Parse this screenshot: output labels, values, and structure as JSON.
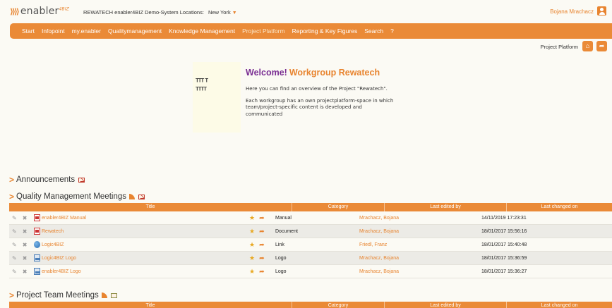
{
  "header": {
    "logo_text": "enabler",
    "logo_sup": "4BIZ",
    "org_label": "REWATECH enabler4BIZ Demo-System",
    "locations_label": "Locations:",
    "location": "New York",
    "user_name": "Bojana Mrachacz"
  },
  "nav": {
    "items": [
      "Start",
      "Infopoint",
      "my.enabler",
      "Qualitymanagement",
      "Knowledge Management",
      "Project Platform",
      "Reporting & Key Figures",
      "Search",
      "?"
    ]
  },
  "breadcrumb": "Project Platform",
  "welcome": {
    "title": "Welcome!",
    "group": "Workgroup Rewatech",
    "p1": "Here you can find an overview of the Project \"Rewatech\".",
    "p2": "Each workgroup has an own projectplatform-space in which team/project-specific content is developed and communicated"
  },
  "sections": {
    "announcements": "Announcements",
    "qm_meetings": "Quality Management Meetings",
    "team_meetings": "Project Team Meetings"
  },
  "table_headers": {
    "title": "Title",
    "category": "Category",
    "last_edited_by": "Last edited by",
    "last_changed_on": "Last changed on"
  },
  "qm_rows": [
    {
      "title": "enabler4BIZ Manual",
      "type": "pdf",
      "category": "Manual",
      "edited_by": "Mrachacz, Bojana",
      "changed": "14/11/2019 17:23:31"
    },
    {
      "title": "Rewatech",
      "type": "pdf",
      "category": "Document",
      "edited_by": "Mrachacz, Bojana",
      "changed": "18/01/2017 15:56:16"
    },
    {
      "title": "Logic4BIZ",
      "type": "link",
      "category": "Link",
      "edited_by": "Friedl, Franz",
      "changed": "18/01/2017 15:40:48"
    },
    {
      "title": "Logic4BIZ Logo",
      "type": "img",
      "category": "Logo",
      "edited_by": "Mrachacz, Bojana",
      "changed": "18/01/2017 15:36:59"
    },
    {
      "title": "enabler4BIZ Logo",
      "type": "img",
      "category": "Logo",
      "edited_by": "Mrachacz, Bojana",
      "changed": "18/01/2017 15:36:27"
    }
  ],
  "colors": {
    "accent": "#ea8a37",
    "title_purple": "#7a2f93"
  },
  "icons": {
    "edit": "pencil-icon",
    "delete": "delete-icon",
    "favorite": "star-icon",
    "share": "share-icon",
    "home": "home-icon"
  }
}
